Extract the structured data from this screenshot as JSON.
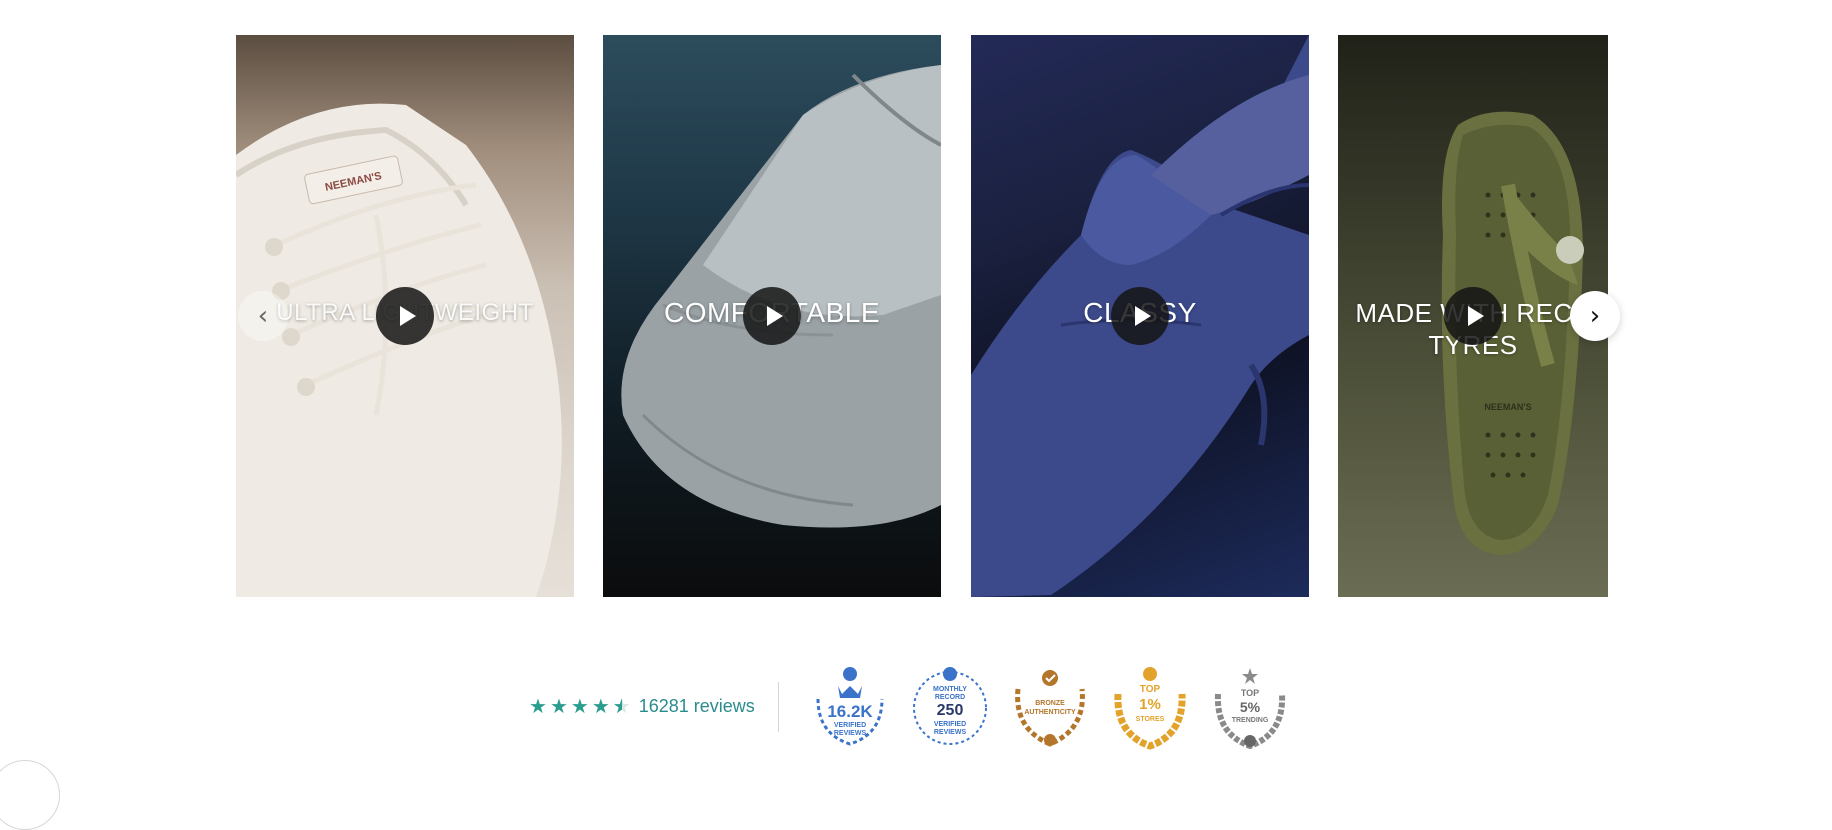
{
  "carousel": {
    "cards": [
      {
        "caption": "ULTRA LIGHTWEIGHT"
      },
      {
        "caption": "COMFORTABLE"
      },
      {
        "caption": "CLASSY"
      },
      {
        "caption": "MADE WITH RECY TYRES"
      }
    ],
    "prev_icon": "chevron-left-icon",
    "next_icon": "chevron-right-icon",
    "play_icon": "play-icon"
  },
  "reviews": {
    "rating": 4.5,
    "count_label": "16281 reviews",
    "star_color": "#2a9d8f"
  },
  "badges": [
    {
      "name": "verified-reviews",
      "line1": "16.2K",
      "line2": "VERIFIED",
      "line3": "REVIEWS",
      "color": "#3a73c9"
    },
    {
      "name": "monthly-record",
      "line1": "MONTHLY",
      "line2": "RECORD",
      "line3": "250",
      "line4": "VERIFIED",
      "line5": "REVIEWS",
      "color": "#3a73c9"
    },
    {
      "name": "bronze-authenticity",
      "line1": "BRONZE",
      "line2": "AUTHENTICITY",
      "color": "#b3762a"
    },
    {
      "name": "top-stores",
      "line1": "TOP",
      "line2": "1%",
      "line3": "STORES",
      "color": "#e3a32b"
    },
    {
      "name": "top-trending",
      "line1": "TOP",
      "line2": "5%",
      "line3": "TRENDING",
      "color": "#8a8a8a"
    }
  ]
}
